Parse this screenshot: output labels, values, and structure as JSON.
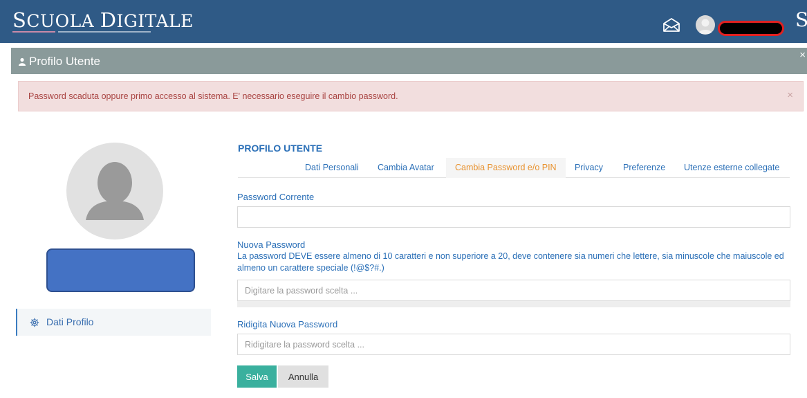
{
  "header": {
    "logo_first_initial": "S",
    "logo_first_rest": "CUOLA",
    "logo_second_initial": "D",
    "logo_second_rest": "IGITALE",
    "truncated_user_text": "S",
    "mail_icon": "envelope-open-icon",
    "avatar_icon": "user-avatar-icon"
  },
  "modal": {
    "title": "Profilo Utente",
    "close_label": "×",
    "alert_text": "Password scaduta oppure primo accesso al sistema. E' necessario eseguire il cambio password.",
    "alert_close_label": "×"
  },
  "sidebar": {
    "item_label": "Dati Profilo",
    "item_icon": "gear-icon"
  },
  "profile": {
    "section_title": "PROFILO UTENTE",
    "tabs": [
      {
        "label": "Dati Personali"
      },
      {
        "label": "Cambia Avatar"
      },
      {
        "label": "Cambia Password e/o PIN"
      },
      {
        "label": "Privacy"
      },
      {
        "label": "Preferenze"
      },
      {
        "label": "Utenze esterne collegate"
      }
    ],
    "active_tab": "Cambia Password e/o PIN"
  },
  "form": {
    "current_password_label": "Password Corrente",
    "current_password_value": "",
    "new_password_label": "Nuova Password",
    "new_password_help": "La password DEVE essere almeno di 10 caratteri e non superiore a 20, deve contenere sia numeri che lettere, sia minuscole che maiuscole ed almeno un carattere speciale (!@$?#.)",
    "new_password_placeholder": "Digitare la password scelta ...",
    "repeat_password_label": "Ridigita Nuova Password",
    "repeat_password_placeholder": "Ridigitare la password scelta ...",
    "save_label": "Salva",
    "cancel_label": "Annulla"
  },
  "colors": {
    "header_bg": "#2f5a86",
    "modal_header_bg": "#8a9a9a",
    "link_blue": "#2a6fb7",
    "active_tab_orange": "#e8912d",
    "save_button": "#3ab09e",
    "alert_bg": "#f2dede",
    "alert_text": "#a94442"
  }
}
